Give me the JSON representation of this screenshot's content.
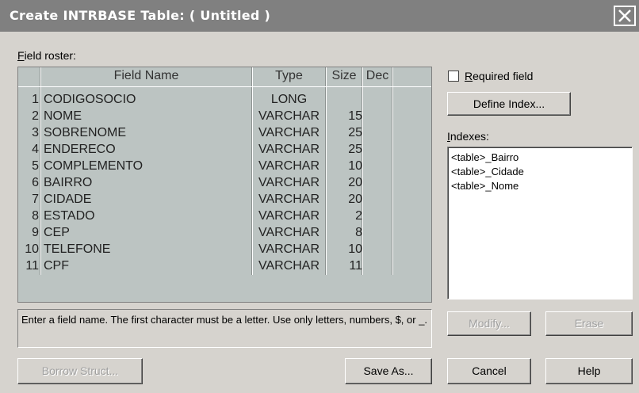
{
  "window": {
    "title": "Create INTRBASE Table:  ( Untitled )",
    "close_icon": "close-icon"
  },
  "field_roster": {
    "label": "Field roster:"
  },
  "grid": {
    "columns": [
      "Field Name",
      "Type",
      "Size",
      "Dec"
    ],
    "rows": [
      {
        "num": "1",
        "name": "CODIGOSOCIO",
        "type": "LONG",
        "size": ""
      },
      {
        "num": "2",
        "name": "NOME",
        "type": "VARCHAR",
        "size": "15"
      },
      {
        "num": "3",
        "name": "SOBRENOME",
        "type": "VARCHAR",
        "size": "25"
      },
      {
        "num": "4",
        "name": "ENDERECO",
        "type": "VARCHAR",
        "size": "25"
      },
      {
        "num": "5",
        "name": "COMPLEMENTO",
        "type": "VARCHAR",
        "size": "10"
      },
      {
        "num": "6",
        "name": "BAIRRO",
        "type": "VARCHAR",
        "size": "20"
      },
      {
        "num": "7",
        "name": "CIDADE",
        "type": "VARCHAR",
        "size": "20"
      },
      {
        "num": "8",
        "name": "ESTADO",
        "type": "VARCHAR",
        "size": "2"
      },
      {
        "num": "9",
        "name": "CEP",
        "type": "VARCHAR",
        "size": "8"
      },
      {
        "num": "10",
        "name": "TELEFONE",
        "type": "VARCHAR",
        "size": "10"
      },
      {
        "num": "11",
        "name": "CPF",
        "type": "VARCHAR",
        "size": "11"
      }
    ]
  },
  "required_field": {
    "label": "Required field",
    "checked": false
  },
  "define_index_button": "Define Index...",
  "indexes": {
    "label": "Indexes:",
    "items": [
      "<table>_Bairro",
      "<table>_Cidade",
      "<table>_Nome"
    ]
  },
  "status_message": "Enter a field name. The first character must be a letter. Use only letters, numbers, $, or _.",
  "buttons": {
    "modify": "Modify...",
    "erase": "Erase",
    "borrow_struct": "Borrow Struct...",
    "save_as": "Save As...",
    "cancel": "Cancel",
    "help": "Help"
  }
}
